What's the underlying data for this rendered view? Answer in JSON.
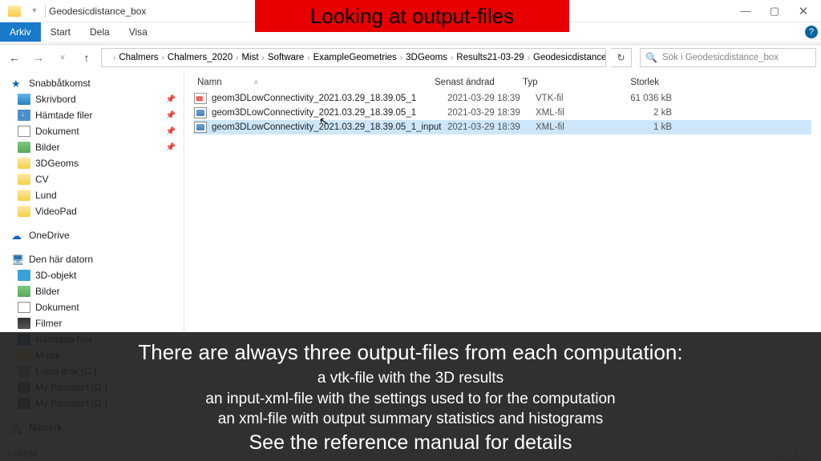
{
  "window": {
    "title": "Geodesicdistance_box",
    "min": "—",
    "max": "▢",
    "close": "✕"
  },
  "ribbon": {
    "tabs": [
      "Arkiv",
      "Start",
      "Dela",
      "Visa"
    ]
  },
  "breadcrumb": {
    "items": [
      "Chalmers",
      "Chalmers_2020",
      "Mist",
      "Software",
      "ExampleGeometries",
      "3DGeoms",
      "Results21-03-29",
      "Geodesicdistance_box"
    ]
  },
  "search": {
    "placeholder": "Sök i Geodesicdistance_box"
  },
  "sidebar": {
    "quick": {
      "label": "Snabbåtkomst"
    },
    "quick_items": [
      {
        "label": "Skrivbord",
        "pin": true,
        "ico": "ico-desktop"
      },
      {
        "label": "Hämtade filer",
        "pin": true,
        "ico": "ico-download"
      },
      {
        "label": "Dokument",
        "pin": true,
        "ico": "ico-doc"
      },
      {
        "label": "Bilder",
        "pin": true,
        "ico": "ico-pic"
      },
      {
        "label": "3DGeoms",
        "pin": false,
        "ico": "ico-folder"
      },
      {
        "label": "CV",
        "pin": false,
        "ico": "ico-folder"
      },
      {
        "label": "Lund",
        "pin": false,
        "ico": "ico-folder"
      },
      {
        "label": "VideoPad",
        "pin": false,
        "ico": "ico-folder"
      }
    ],
    "onedrive": {
      "label": "OneDrive"
    },
    "pc": {
      "label": "Den här datorn"
    },
    "pc_items": [
      {
        "label": "3D-objekt",
        "ico": "ico-3d"
      },
      {
        "label": "Bilder",
        "ico": "ico-pic"
      },
      {
        "label": "Dokument",
        "ico": "ico-doc"
      },
      {
        "label": "Filmer",
        "ico": "ico-film"
      },
      {
        "label": "Hämtade filer",
        "ico": "ico-download"
      },
      {
        "label": "Musik",
        "ico": "ico-folder"
      },
      {
        "label": "Lokal disk (C:)",
        "ico": "ico-disk"
      },
      {
        "label": "My Passport (D:)",
        "ico": "ico-drive"
      },
      {
        "label": "My Passport (D:)",
        "ico": "ico-drive"
      }
    ],
    "network": {
      "label": "Nätverk"
    }
  },
  "columns": {
    "name": "Namn",
    "date": "Senast ändrad",
    "type": "Typ",
    "size": "Storlek"
  },
  "files": [
    {
      "name": "geom3DLowConnectivity_2021.03.29_18.39.05_1",
      "date": "2021-03-29 18:39",
      "type": "VTK-fil",
      "size": "61 036 kB",
      "ico": "vtk",
      "selected": false
    },
    {
      "name": "geom3DLowConnectivity_2021.03.29_18.39.05_1",
      "date": "2021-03-29 18:39",
      "type": "XML-fil",
      "size": "2 kB",
      "ico": "xml",
      "selected": false
    },
    {
      "name": "geom3DLowConnectivity_2021.03.29_18.39.05_1_input",
      "date": "2021-03-29 18:39",
      "type": "XML-fil",
      "size": "1 kB",
      "ico": "xml",
      "selected": true
    }
  ],
  "status": {
    "count": "3 objekt"
  },
  "overlay": {
    "banner": "Looking at output-files",
    "c1": "There are always three output-files from each computation:",
    "c2": "a vtk-file with the 3D results",
    "c3": "an input-xml-file with the settings used to for the computation",
    "c4": "an xml-file with output summary statistics and histograms",
    "c5": "See the reference manual for details"
  }
}
